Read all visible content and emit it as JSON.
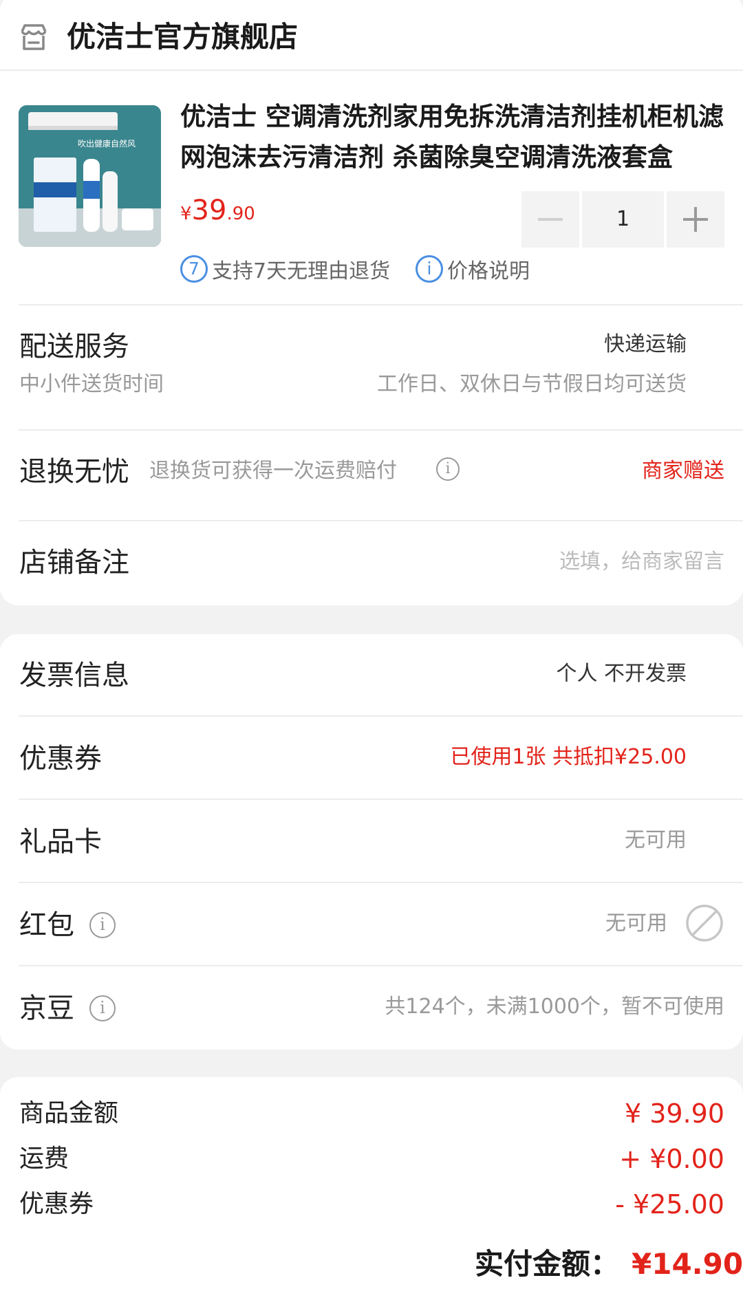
{
  "store": {
    "name": "优洁士官方旗舰店"
  },
  "product": {
    "title": "优洁士 空调清洗剂家用免拆洗清洁剂挂机柜机滤网泡沫去污清洁剂 杀菌除臭空调清洗液套盒",
    "image_caption": "吹出健康自然风",
    "price": {
      "currency": "¥",
      "integer": "39",
      "decimal": ".90"
    },
    "quantity": "1",
    "tags": [
      {
        "badge": "7",
        "text": "支持7天无理由退货"
      },
      {
        "badge": "i",
        "text": "价格说明"
      }
    ]
  },
  "delivery": {
    "title": "配送服务",
    "value": "快递运输",
    "sub_label": "中小件送货时间",
    "sub_value": "工作日、双休日与节假日均可送货"
  },
  "returns": {
    "title": "退换无忧",
    "desc": "退换货可获得一次运费赔付",
    "value": "商家赠送"
  },
  "remark": {
    "title": "店铺备注",
    "placeholder": "选填，给商家留言"
  },
  "invoice": {
    "title": "发票信息",
    "value": "个人 不开发票"
  },
  "coupon": {
    "title": "优惠券",
    "value": "已使用1张 共抵扣¥25.00"
  },
  "giftcard": {
    "title": "礼品卡",
    "value": "无可用"
  },
  "redpacket": {
    "title": "红包",
    "value": "无可用"
  },
  "jingdou": {
    "title": "京豆",
    "value": "共124个，未满1000个，暂不可使用"
  },
  "summary": {
    "goods_label": "商品金额",
    "goods_value": "¥ 39.90",
    "shipping_label": "运费",
    "shipping_value": "+ ¥0.00",
    "coupon_label": "优惠券",
    "coupon_value": "- ¥25.00",
    "total_label": "实付金额：",
    "total_value": "¥14.90"
  },
  "colors": {
    "accent_red": "#e2231a",
    "tag_blue": "#4a8fe3"
  }
}
